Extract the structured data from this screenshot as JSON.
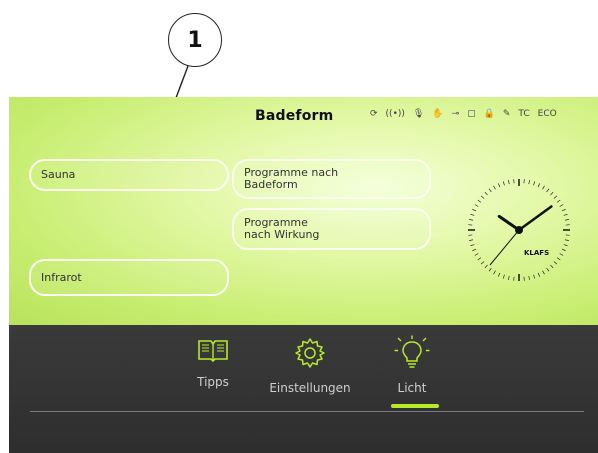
{
  "callout": {
    "number": "1"
  },
  "header": {
    "title": "Badeform"
  },
  "status_icons": [
    "sync-icon",
    "wireless-icon",
    "microphone-icon",
    "hand-icon",
    "key-icon",
    "speaker-icon",
    "lock-icon",
    "tools-icon",
    "TC",
    "ECO"
  ],
  "status_text": {
    "tc": "TC",
    "eco": "ECO"
  },
  "buttons": {
    "sauna": "Sauna",
    "infrarot": "Infrarot",
    "prog_badeform_1": "Programme nach",
    "prog_badeform_2": "Badeform",
    "prog_wirkung_1": "Programme",
    "prog_wirkung_2": "nach Wirkung"
  },
  "clock": {
    "brand": "KLAFS",
    "hour": 10,
    "minute": 9
  },
  "nav": {
    "tipps": "Tipps",
    "einstellungen": "Einstellungen",
    "licht": "Licht",
    "active": "licht"
  },
  "colors": {
    "accent": "#b8ea2a",
    "panel_dark": "#333333",
    "panel_green": "#cdee78"
  }
}
